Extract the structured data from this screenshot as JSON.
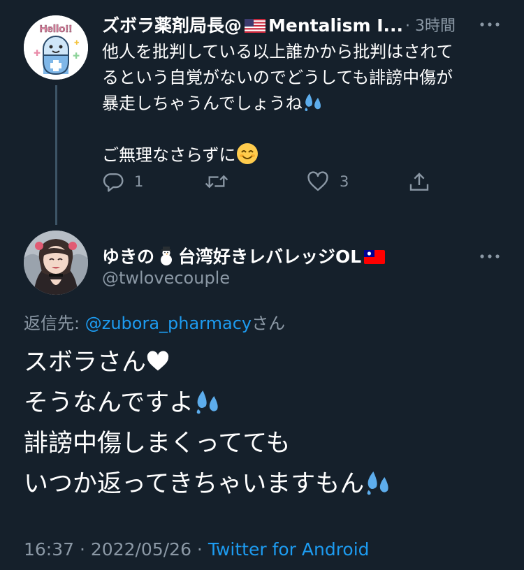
{
  "parent_tweet": {
    "display_name_part1": "ズボラ薬剤局長@",
    "display_name_part2": "Mentalism I...",
    "time_ago": "3時間",
    "text_lines": [
      "他人を批判している以上誰かから批判はされて",
      "るという自覚がないのでどうしても誹謗中傷が",
      "暴走しちゃうんでしょうね"
    ],
    "text_line_4": "ご無理なさらずに",
    "reply_count": "1",
    "like_count": "3",
    "avatar_text": "Hello!!"
  },
  "reply_tweet": {
    "display_name_part1": "ゆきの",
    "display_name_part2": "台湾好きレバレッジOL",
    "handle": "@twlovecouple",
    "reply_to_label": "返信先: ",
    "reply_to_mention": "@zubora_pharmacy",
    "reply_to_suffix": "さん",
    "body_lines": [
      "スボラさん",
      "そうなんですよ",
      "誹謗中傷しまくってても",
      "いつか返ってきちゃいますもん"
    ],
    "time": "16:37",
    "separator": " · ",
    "date": "2022/05/26",
    "source": "Twitter for Android"
  },
  "icons": {
    "more": "more-icon",
    "reply": "reply-icon",
    "retweet": "retweet-icon",
    "like": "heart-icon",
    "share": "share-icon"
  },
  "colors": {
    "background": "#15202b",
    "secondary_text": "#8b98a5",
    "link": "#1d9bf0"
  }
}
